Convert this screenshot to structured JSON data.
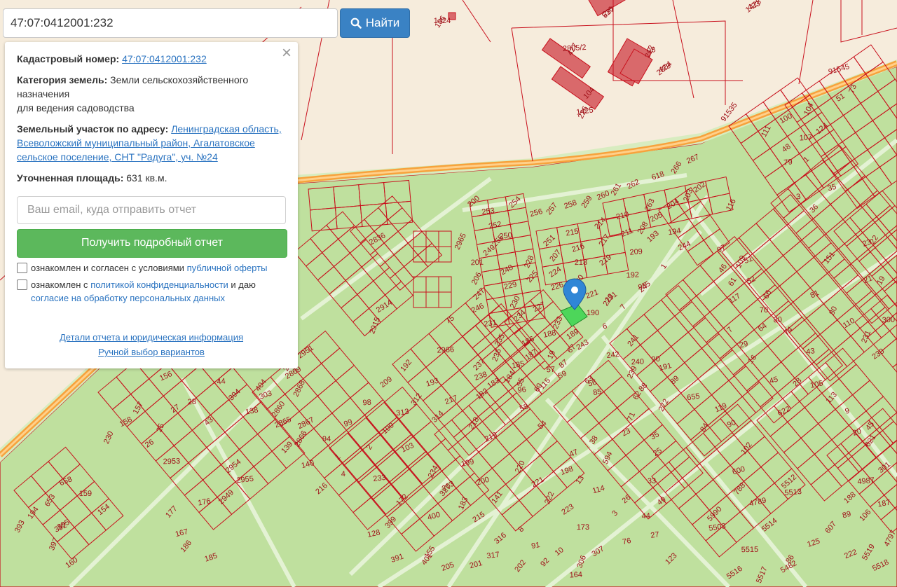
{
  "search": {
    "value": "47:07:0412001:232",
    "button_label": "Найти"
  },
  "info": {
    "cad_label": "Кадастровый номер:",
    "cad_value": "47:07:0412001:232",
    "category_label": "Категория земель:",
    "category_value": "Земли сельскохозяйственного назначения",
    "category_use": "для ведения садоводства",
    "address_label": "Земельный участок по адресу:",
    "address_value": "Ленинградская область, Всеволожский муниципальный район, Агалатовское сельское поселение, СНТ \"Радуга\", уч. №24",
    "area_label": "Уточненная площадь:",
    "area_value": "631 кв.м.",
    "email_placeholder": "Ваш email, куда отправить отчет",
    "report_button": "Получить подробный отчет",
    "check1_text": "ознакомлен и согласен с условиями",
    "check1_link": "публичной оферты",
    "check2_text": "ознакомлен с",
    "check2_link": "политикой конфиденциальности",
    "check2_and": "и даю",
    "check2_link2": "согласие на обработку персональных данных",
    "details_link": "Детали отчета и юридическая информация",
    "manual_link": "Ручной выбор вариантов"
  },
  "colors": {
    "map_bg": "#f6ecdc",
    "parcel_fill": "#bfe09e",
    "parcel_line": "#c8101c",
    "road": "#f7a23c",
    "building": "#d9696b",
    "accent": "#3a82c4",
    "report": "#5cb85c"
  },
  "map_labels": [
    "1424",
    "1428",
    "2805/2",
    "2804",
    "1425",
    "516",
    "98",
    "104",
    "91545",
    "91535",
    "618",
    "266",
    "267",
    "116",
    "2836",
    "2965",
    "2914",
    "2915",
    "75",
    "2966",
    "200",
    "253",
    "254",
    "252",
    "255",
    "256",
    "257",
    "258",
    "259",
    "260",
    "261",
    "262",
    "263",
    "204",
    "203",
    "202",
    "201",
    "249",
    "250",
    "251",
    "215",
    "214",
    "210",
    "207",
    "216",
    "217",
    "211",
    "208",
    "205",
    "206",
    "248",
    "228",
    "224",
    "218",
    "219",
    "209",
    "193",
    "194",
    "247",
    "229",
    "225",
    "226",
    "220",
    "221",
    "222",
    "246",
    "230",
    "227",
    "233",
    "189",
    "190",
    "191",
    "192",
    "245",
    "231",
    "234",
    "188",
    "67",
    "6",
    "7",
    "95",
    "1",
    "244",
    "235",
    "186",
    "19",
    "243",
    "236",
    "187",
    "57",
    "87",
    "242",
    "237",
    "185",
    "115",
    "56",
    "241",
    "238",
    "184",
    "58",
    "60",
    "59",
    "239",
    "183",
    "55",
    "63",
    "240",
    "182",
    "96",
    "54",
    "85",
    "88",
    "191",
    "192",
    "193",
    "312",
    "217",
    "218",
    "219",
    "220",
    "221",
    "222",
    "223",
    "173",
    "209",
    "98",
    "100",
    "313",
    "314",
    "199",
    "327",
    "200",
    "141",
    "99",
    "2",
    "103",
    "234",
    "203",
    "183",
    "215",
    "94",
    "1",
    "4",
    "216",
    "233",
    "172",
    "128",
    "399",
    "400",
    "401",
    "391",
    "155",
    "156",
    "157",
    "158",
    "230",
    "26",
    "25",
    "27",
    "28",
    "43",
    "44",
    "394",
    "138",
    "139",
    "140",
    "404",
    "303",
    "2860",
    "2865",
    "2866",
    "2867",
    "2868",
    "2869",
    "2870",
    "2951",
    "2953",
    "2954",
    "2955",
    "2949",
    "176",
    "177",
    "167",
    "186",
    "185",
    "194",
    "658",
    "653",
    "392",
    "393",
    "395",
    "397",
    "160",
    "159",
    "154",
    "90",
    "89",
    "655",
    "7",
    "29",
    "16",
    "45",
    "46",
    "51",
    "61",
    "52",
    "66",
    "97",
    "109",
    "117",
    "70",
    "64",
    "80",
    "74",
    "43",
    "28",
    "105",
    "113",
    "9",
    "45",
    "20",
    "621",
    "622",
    "111",
    "100",
    "104",
    "51",
    "73",
    "48",
    "107",
    "124",
    "79",
    "1",
    "3",
    "36",
    "35",
    "151",
    "23",
    "22",
    "21",
    "19",
    "81",
    "80",
    "110",
    "231",
    "230",
    "300",
    "301",
    "4987",
    "188",
    "187",
    "106",
    "89",
    "607",
    "125",
    "86",
    "222",
    "5519",
    "5518",
    "4797",
    "5482",
    "5517",
    "5516",
    "5515",
    "5514",
    "5513",
    "5512",
    "5503",
    "5990",
    "4789",
    "788",
    "600",
    "102",
    "90",
    "84",
    "119",
    "272",
    "35",
    "71",
    "25",
    "33",
    "49",
    "44",
    "26",
    "27",
    "123",
    "76",
    "3",
    "114",
    "13",
    "198",
    "38",
    "47",
    "62",
    "23",
    "594",
    "307",
    "306",
    "10",
    "164",
    "316",
    "317",
    "8",
    "91",
    "92",
    "201",
    "202",
    "205",
    "106",
    "423",
    "427",
    "429",
    "226",
    "237",
    "212"
  ]
}
